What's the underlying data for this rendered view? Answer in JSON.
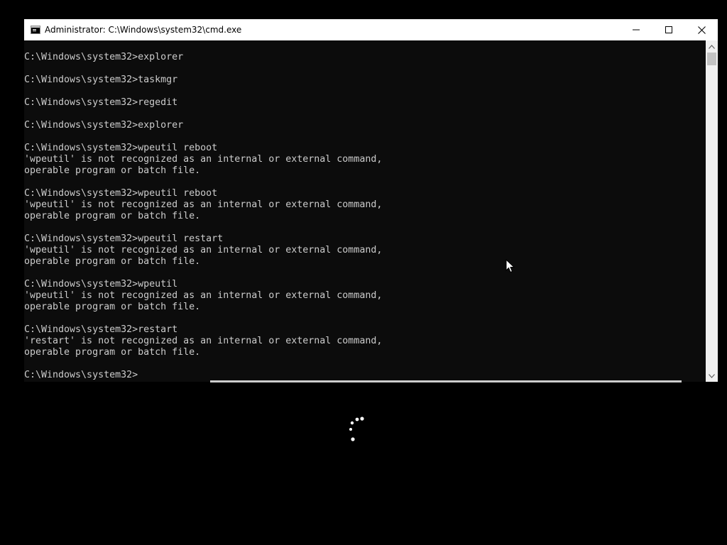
{
  "window": {
    "title": "Administrator: C:\\Windows\\system32\\cmd.exe",
    "icon": "console-app-icon",
    "controls": {
      "minimize": "minimize-icon",
      "maximize": "maximize-icon",
      "close": "close-icon"
    }
  },
  "console": {
    "lines": [
      "C:\\Windows\\system32>explorer",
      "",
      "C:\\Windows\\system32>taskmgr",
      "",
      "C:\\Windows\\system32>regedit",
      "",
      "C:\\Windows\\system32>explorer",
      "",
      "C:\\Windows\\system32>wpeutil reboot",
      "'wpeutil' is not recognized as an internal or external command,",
      "operable program or batch file.",
      "",
      "C:\\Windows\\system32>wpeutil reboot",
      "'wpeutil' is not recognized as an internal or external command,",
      "operable program or batch file.",
      "",
      "C:\\Windows\\system32>wpeutil restart",
      "'wpeutil' is not recognized as an internal or external command,",
      "operable program or batch file.",
      "",
      "C:\\Windows\\system32>wpeutil",
      "'wpeutil' is not recognized as an internal or external command,",
      "operable program or batch file.",
      "",
      "C:\\Windows\\system32>restart",
      "'restart' is not recognized as an internal or external command,",
      "operable program or batch file.",
      "",
      "C:\\Windows\\system32>"
    ]
  },
  "colors": {
    "console_background": "#0c0c0c",
    "console_text": "#cccccc",
    "title_bar": "#ffffff",
    "desktop": "#000000"
  },
  "overlay": {
    "spinner": "loading-spinner-icon",
    "cursor": "mouse-pointer-icon"
  }
}
